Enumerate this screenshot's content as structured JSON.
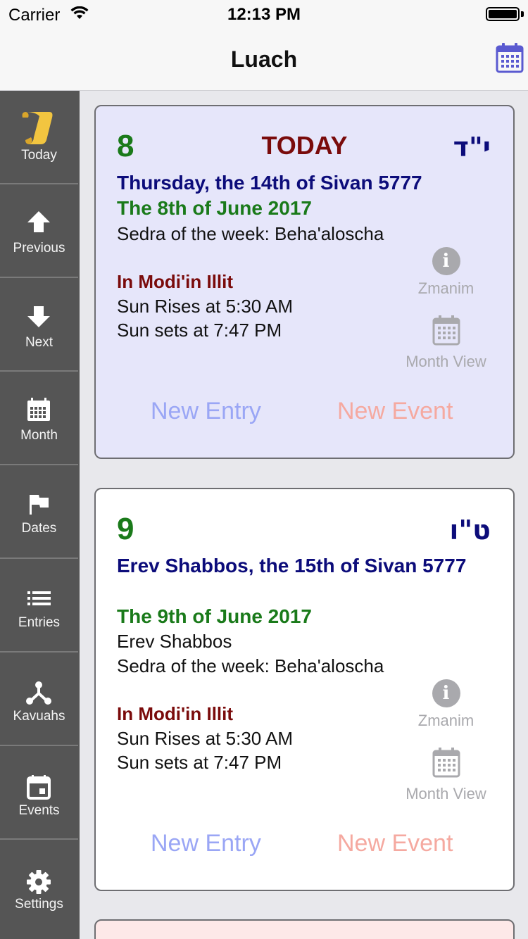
{
  "status_bar": {
    "carrier": "Carrier",
    "time": "12:13 PM"
  },
  "nav": {
    "title": "Luach",
    "calendar_button_icon": "calendar-icon"
  },
  "sidebar": {
    "items": [
      {
        "label": "Today",
        "icon": "scroll-icon"
      },
      {
        "label": "Previous",
        "icon": "arrow-up-icon"
      },
      {
        "label": "Next",
        "icon": "arrow-down-icon"
      },
      {
        "label": "Month",
        "icon": "calendar-icon"
      },
      {
        "label": "Dates",
        "icon": "flag-icon"
      },
      {
        "label": "Entries",
        "icon": "list-icon"
      },
      {
        "label": "Kavuahs",
        "icon": "fork-icon"
      },
      {
        "label": "Events",
        "icon": "event-icon"
      },
      {
        "label": "Settings",
        "icon": "gear-icon"
      }
    ]
  },
  "cards": [
    {
      "day_number": "8",
      "today_label": "TODAY",
      "hebrew_day": "י\"ד",
      "jewish_date": "Thursday, the 14th of Sivan 5777",
      "secular_date": "The 8th of June 2017",
      "extra_lines": [],
      "sedra": "Sedra of the week: Beha'aloscha",
      "location": "In Modi'in Illit",
      "sunrise": "Sun Rises at 5:30 AM",
      "sunset": "Sun sets at 7:47 PM",
      "zmanim_label": "Zmanim",
      "month_view_label": "Month View",
      "new_entry_label": "New Entry",
      "new_event_label": "New Event",
      "background": "#e6e6fa"
    },
    {
      "day_number": "9",
      "hebrew_day": "ט\"ו",
      "jewish_date": "Erev Shabbos, the 15th of Sivan 5777",
      "secular_date": "The 9th of June 2017",
      "extra_lines": [
        "Erev Shabbos"
      ],
      "sedra": "Sedra of the week: Beha'aloscha",
      "location": "In Modi'in Illit",
      "sunrise": "Sun Rises at 5:30 AM",
      "sunset": "Sun sets at 7:47 PM",
      "zmanim_label": "Zmanim",
      "month_view_label": "Month View",
      "new_entry_label": "New Entry",
      "new_event_label": "New Event",
      "background": "#ffffff"
    }
  ],
  "colors": {
    "sidebar_bg": "#555555",
    "jewish_date": "#0c0c7a",
    "secular_date": "#1a7a1a",
    "location": "#7a0b0b",
    "new_entry": "#9aa6f5",
    "new_event": "#f5a9a0",
    "next_card_peek": "#fde8e8"
  }
}
